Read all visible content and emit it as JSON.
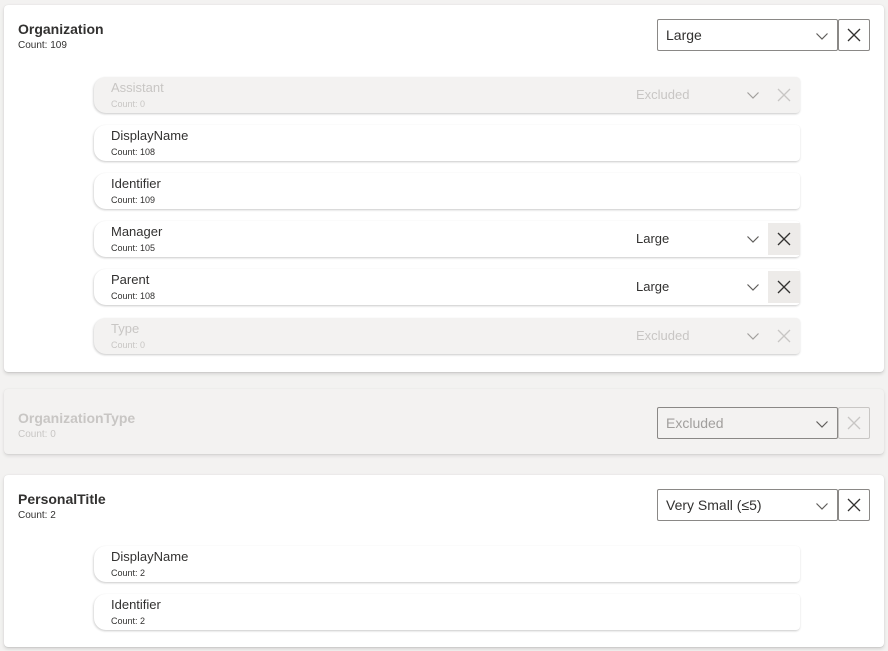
{
  "cards": [
    {
      "title": "Organization",
      "count": "Count: 109",
      "size": "Large",
      "disabled": false,
      "fields": [
        {
          "name": "Assistant",
          "count": "Count: 0",
          "size": "Excluded",
          "disabled": true
        },
        {
          "name": "DisplayName",
          "count": "Count: 108"
        },
        {
          "name": "Identifier",
          "count": "Count: 109"
        },
        {
          "name": "Manager",
          "count": "Count: 105",
          "size": "Large",
          "disabled": false
        },
        {
          "name": "Parent",
          "count": "Count: 108",
          "size": "Large",
          "disabled": false
        },
        {
          "name": "Type",
          "count": "Count: 0",
          "size": "Excluded",
          "disabled": true
        }
      ]
    },
    {
      "title": "OrganizationType",
      "count": "Count: 0",
      "size": "Excluded",
      "disabled": true,
      "fields": []
    },
    {
      "title": "PersonalTitle",
      "count": "Count: 2",
      "size": "Very Small (≤5)",
      "disabled": false,
      "fields": [
        {
          "name": "DisplayName",
          "count": "Count: 2"
        },
        {
          "name": "Identifier",
          "count": "Count: 2"
        }
      ]
    }
  ],
  "icons": {
    "dropdown": "chevron-down-icon",
    "remove": "close-icon"
  },
  "colors": {
    "background": "#f3f2f1",
    "card": "#ffffff",
    "disabled_text": "#c8c6c4",
    "text": "#323130"
  }
}
